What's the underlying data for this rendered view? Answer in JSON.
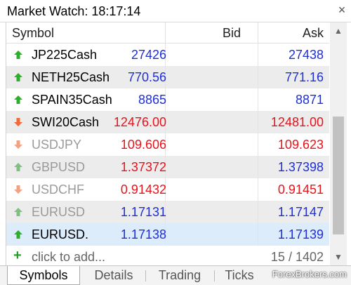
{
  "window": {
    "title": "Market Watch: 18:17:14",
    "close_glyph": "×"
  },
  "columns": {
    "symbol": "Symbol",
    "bid": "Bid",
    "ask": "Ask"
  },
  "rows": [
    {
      "symbol": "JP225Cash",
      "bid": "27426",
      "ask": "27438",
      "direction": "up",
      "color": "#1f2fd4",
      "symbol_color": "#000000"
    },
    {
      "symbol": "NETH25Cash",
      "bid": "770.56",
      "ask": "771.16",
      "direction": "up",
      "color": "#1f2fd4",
      "symbol_color": "#000000"
    },
    {
      "symbol": "SPAIN35Cash",
      "bid": "8865",
      "ask": "8871",
      "direction": "up",
      "color": "#1f2fd4",
      "symbol_color": "#000000"
    },
    {
      "symbol": "SWI20Cash",
      "bid": "12476.00",
      "ask": "12481.00",
      "direction": "down",
      "color": "#e8121a",
      "symbol_color": "#000000"
    },
    {
      "symbol": "USDJPY",
      "bid": "109.606",
      "ask": "109.623",
      "direction": "down",
      "color": "#e8121a",
      "symbol_color": "#9a9a9a"
    },
    {
      "symbol": "GBPUSD",
      "bid": "1.37372",
      "ask": "1.37398",
      "direction": "up",
      "color": "#e8121a",
      "ask_color": "#1f2fd4",
      "symbol_color": "#9a9a9a"
    },
    {
      "symbol": "USDCHF",
      "bid": "0.91432",
      "ask": "0.91451",
      "direction": "down",
      "color": "#e8121a",
      "symbol_color": "#9a9a9a"
    },
    {
      "symbol": "EURUSD",
      "bid": "1.17131",
      "ask": "1.17147",
      "direction": "up",
      "color": "#1f2fd4",
      "symbol_color": "#9a9a9a"
    },
    {
      "symbol": "EURUSD.",
      "bid": "1.17138",
      "ask": "1.17139",
      "direction": "up",
      "color": "#1f2fd4",
      "symbol_color": "#000000",
      "selected": true
    }
  ],
  "add_row": {
    "label": "click to add...",
    "count": "15 / 1402"
  },
  "tabs": [
    {
      "label": "Symbols",
      "active": true
    },
    {
      "label": "Details",
      "active": false
    },
    {
      "label": "Trading",
      "active": false
    },
    {
      "label": "Ticks",
      "active": false
    }
  ],
  "watermark": "ForexBrokers.com",
  "colors": {
    "up_arrow": "#2bb02b",
    "up_arrow_dim": "#7fbf7f",
    "down_arrow": "#f06a3c",
    "down_arrow_dim": "#f0a284"
  }
}
